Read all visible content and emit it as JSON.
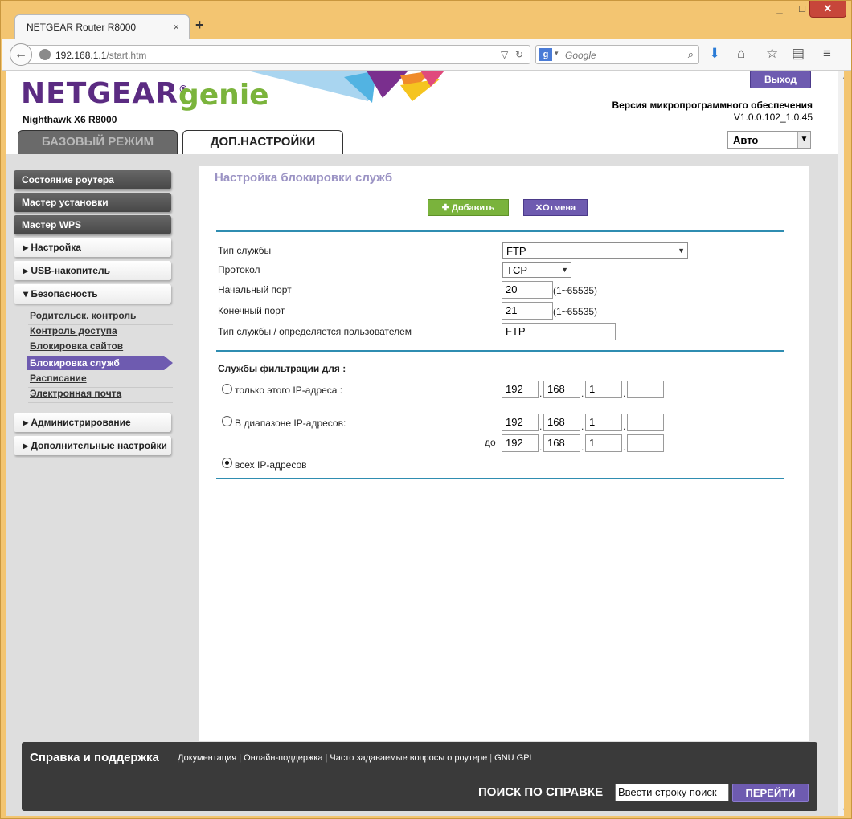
{
  "window": {
    "minimize": "_",
    "maximize": "□",
    "close": "✕"
  },
  "tab": {
    "title": "NETGEAR Router R8000",
    "close": "×",
    "new": "+"
  },
  "navbar": {
    "url_host": "192.168.1.1",
    "url_path": "/start.htm",
    "search_placeholder": "Google",
    "search_engine_letter": "g"
  },
  "header": {
    "logo_brand": "NETGEAR",
    "logo_product": "genie",
    "model": "Nighthawk X6 R8000",
    "logout": "Выход",
    "firmware_label": "Версия микропрограммного обеспечения",
    "firmware_version": "V1.0.0.102_1.0.45",
    "mode_value": "Авто",
    "tab_basic": "БАЗОВЫЙ РЕЖИМ",
    "tab_advanced": "ДОП.НАСТРОЙКИ"
  },
  "sidebar": {
    "router_status": "Состояние роутера",
    "setup_wizard": "Мастер установки",
    "wps_wizard": "Мастер WPS",
    "setup": "▸ Настройка",
    "usb": "▸ USB-накопитель",
    "security": "▾ Безопасность",
    "security_items": [
      "Родительск. контроль",
      "Контроль доступа",
      "Блокировка сайтов",
      "Блокировка служб",
      "Расписание",
      "Электронная почта"
    ],
    "admin": "▸ Администрирование",
    "advanced_setup": "▸ Дополнительные настройки"
  },
  "content": {
    "title": "Настройка блокировки служб",
    "add_button": "✚ Добавить",
    "cancel_button": "✕Отмена",
    "service_type_label": "Тип службы",
    "service_type_value": "FTP",
    "protocol_label": "Протокол",
    "protocol_value": "TCP",
    "start_port_label": "Начальный порт",
    "start_port_value": "20",
    "end_port_label": "Конечный порт",
    "end_port_value": "21",
    "port_range_hint": "(1~65535)",
    "user_defined_label": "Тип службы / определяется пользователем",
    "user_defined_value": "FTP",
    "filter_section": "Службы фильтрации для :",
    "only_ip_label": "только этого IP-адреса :",
    "range_label": "В диапазоне IP-адресов:",
    "to_label": "до",
    "all_ip_label": "всех IP-адресов",
    "only_ip": [
      "192",
      "168",
      "1",
      ""
    ],
    "range_from": [
      "192",
      "168",
      "1",
      ""
    ],
    "range_to": [
      "192",
      "168",
      "1",
      ""
    ],
    "selected_filter": "all"
  },
  "footer": {
    "title": "Справка и поддержка",
    "links": [
      "Документация",
      "Онлайн-поддержка",
      "Часто задаваемые вопросы о роутере",
      "GNU GPL"
    ],
    "search_label": "ПОИСК ПО СПРАВКЕ",
    "search_value": "Ввести строку поиск",
    "go_button": "ПЕРЕЙТИ"
  },
  "colors": {
    "brand_purple": "#5b2b82",
    "genie_green": "#7bb43c",
    "accent_purple": "#6e5bb0",
    "divider_blue": "#2f8db1",
    "window_frame": "#f3c571"
  }
}
